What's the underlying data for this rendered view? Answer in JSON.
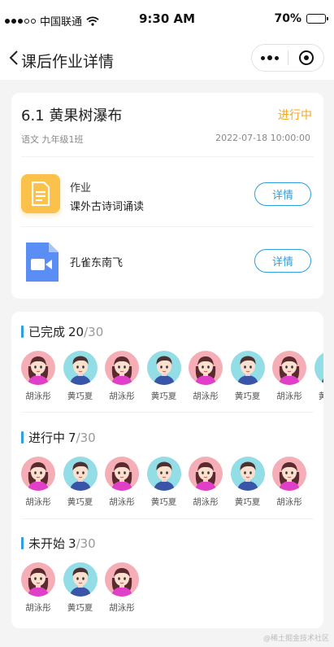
{
  "status_bar": {
    "carrier": "中国联通",
    "time": "9:30 AM",
    "battery": "70%",
    "battery_level": 0.7
  },
  "nav": {
    "title": "课后作业详情"
  },
  "task": {
    "title": "6.1 黄果树瀑布",
    "status": "进行中",
    "meta": "语文 九年级1班",
    "datetime": "2022-07-18  10:00:00",
    "items": [
      {
        "type": "作业",
        "name": "课外古诗词诵读",
        "icon": "document-icon",
        "button": "详情"
      },
      {
        "type": "",
        "name": "孔雀东南飞",
        "icon": "video-file-icon",
        "button": "详情"
      }
    ]
  },
  "sections": [
    {
      "title": "已完成",
      "done": "20",
      "total": "/30",
      "students": [
        {
          "name": "胡泳彤",
          "avatar": "girl"
        },
        {
          "name": "黄巧夏",
          "avatar": "boy"
        },
        {
          "name": "胡泳彤",
          "avatar": "girl"
        },
        {
          "name": "黄巧夏",
          "avatar": "boy"
        },
        {
          "name": "胡泳彤",
          "avatar": "girl"
        },
        {
          "name": "黄巧夏",
          "avatar": "boy"
        },
        {
          "name": "胡泳彤",
          "avatar": "girl"
        },
        {
          "name": "黄巧夏",
          "avatar": "boy"
        }
      ]
    },
    {
      "title": "进行中",
      "done": "7",
      "total": "/30",
      "students": [
        {
          "name": "胡泳彤",
          "avatar": "girl"
        },
        {
          "name": "黄巧夏",
          "avatar": "boy"
        },
        {
          "name": "胡泳彤",
          "avatar": "girl"
        },
        {
          "name": "黄巧夏",
          "avatar": "boy"
        },
        {
          "name": "胡泳彤",
          "avatar": "girl"
        },
        {
          "name": "黄巧夏",
          "avatar": "boy"
        },
        {
          "name": "胡泳彤",
          "avatar": "girl"
        }
      ]
    },
    {
      "title": "未开始",
      "done": "3",
      "total": "/30",
      "students": [
        {
          "name": "胡泳彤",
          "avatar": "girl"
        },
        {
          "name": "黄巧夏",
          "avatar": "boy"
        },
        {
          "name": "胡泳彤",
          "avatar": "girl"
        }
      ]
    }
  ],
  "watermark": "@稀土掘金技术社区",
  "colors": {
    "accent": "#2e9fe0",
    "status": "#f5a623",
    "doc_icon": "#fbc14a",
    "video_icon": "#5b8ef5",
    "girl_bg": "#f6aeb6",
    "boy_bg": "#92dde6"
  }
}
